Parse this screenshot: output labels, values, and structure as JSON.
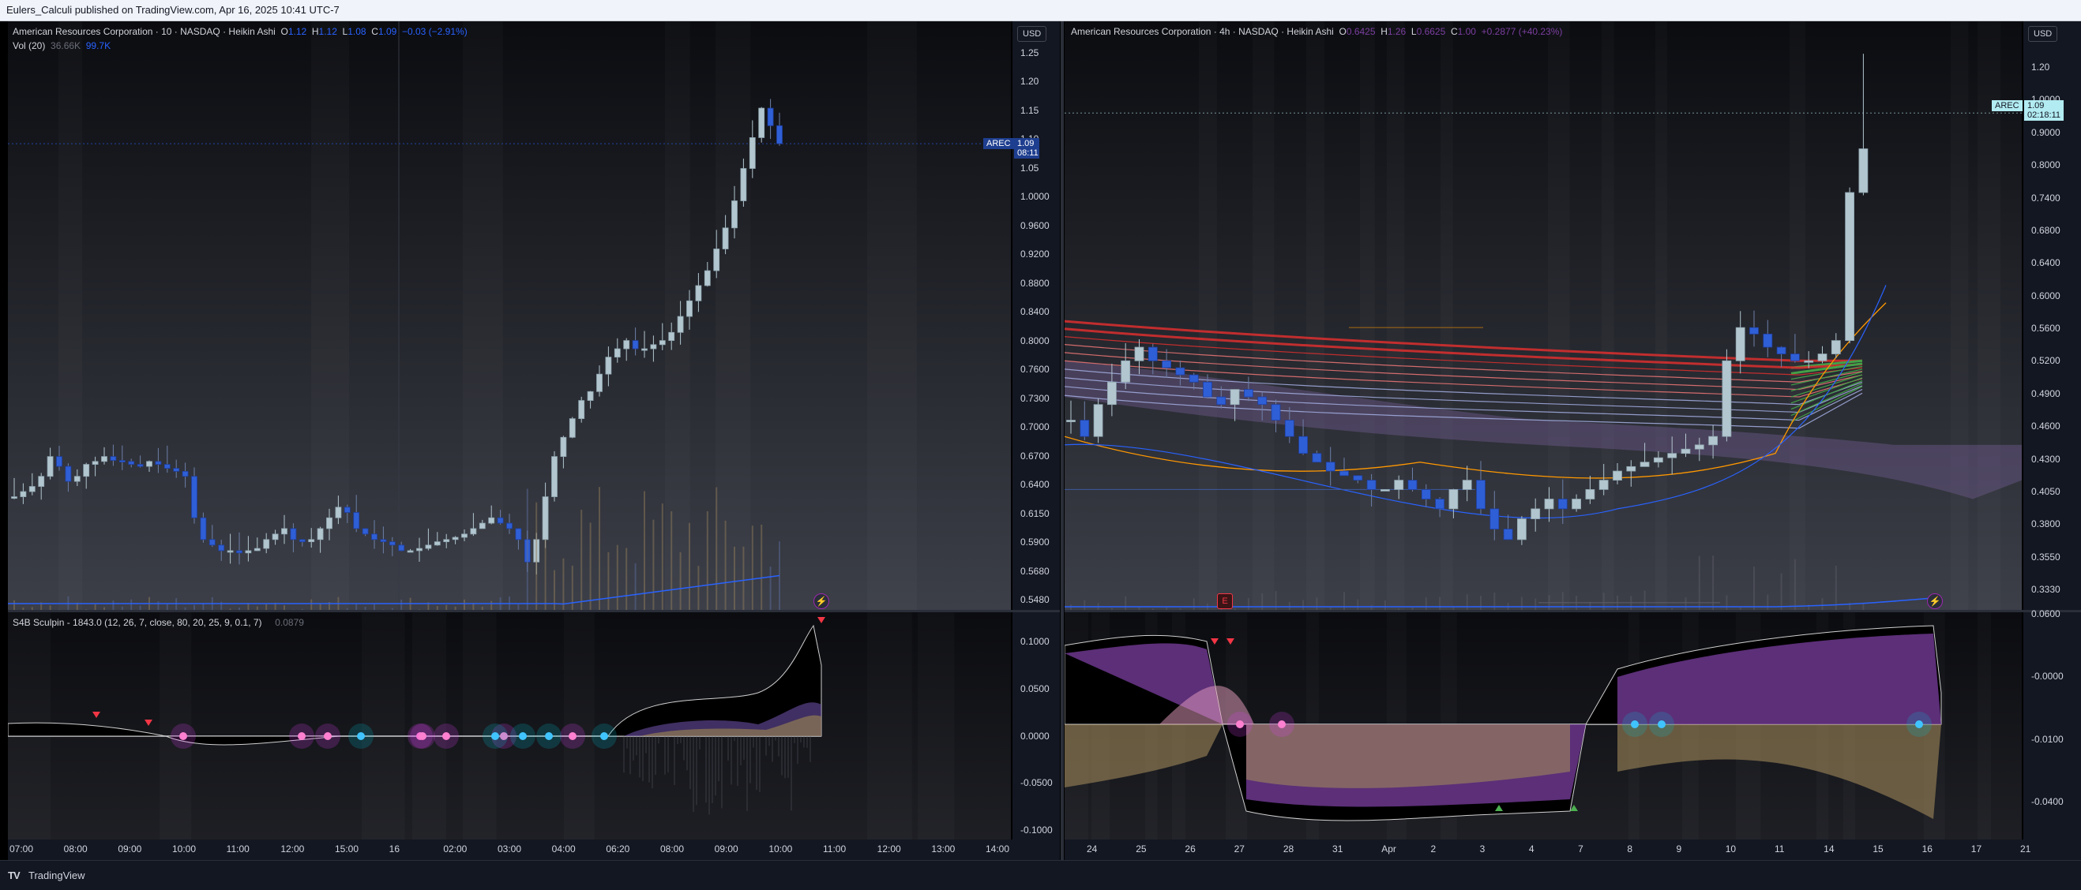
{
  "header": {
    "published_text": "Eulers_Calculi published on TradingView.com, Apr 16, 2025 10:41 UTC-7"
  },
  "left_chart": {
    "legend": {
      "title": "American Resources Corporation · 10 · NASDAQ · Heikin Ashi",
      "o_label": "O",
      "o": "1.12",
      "h_label": "H",
      "h": "1.12",
      "l_label": "L",
      "l": "1.08",
      "c_label": "C",
      "c": "1.09",
      "change": "−0.03 (−2.91%)",
      "vol_label": "Vol (20)",
      "vol_a": "36.66K",
      "vol_b": "99.7K"
    },
    "currency": "USD",
    "price_axis": [
      "1.25",
      "1.20",
      "1.15",
      "1.10",
      "1.05",
      "1.0000",
      "0.9600",
      "0.9200",
      "0.8800",
      "0.8400",
      "0.8000",
      "0.7600",
      "0.7300",
      "0.7000",
      "0.6700",
      "0.6400",
      "0.6150",
      "0.5900",
      "0.5680",
      "0.5480"
    ],
    "ticker_tag": "AREC",
    "last_price": "1.09",
    "countdown": "08:11",
    "indicator_legend": "S4B Sculpin - 1843.0 (12, 26, 7, close, 80, 20, 25, 9, 0.1, 7)",
    "indicator_value": "0.0879",
    "indicator_axis": [
      "0.1000",
      "0.0500",
      "0.0000",
      "-0.0500",
      "-0.1000"
    ],
    "time_axis": [
      "07:00",
      "08:00",
      "09:00",
      "10:00",
      "11:00",
      "12:00",
      "15:00",
      "16",
      "02:00",
      "03:00",
      "04:00",
      "06:20",
      "08:00",
      "09:00",
      "10:00",
      "11:00",
      "12:00",
      "13:00",
      "14:00"
    ]
  },
  "right_chart": {
    "legend": {
      "title": "American Resources Corporation · 4h · NASDAQ · Heikin Ashi",
      "o_label": "O",
      "o": "0.6425",
      "h_label": "H",
      "h": "1.26",
      "l_label": "L",
      "l": "0.6625",
      "c_label": "C",
      "c": "1.00",
      "change": "+0.2877 (+40.23%)"
    },
    "currency": "USD",
    "price_axis": [
      "1.20",
      "1.0000",
      "0.9000",
      "0.8000",
      "0.7400",
      "0.6800",
      "0.6400",
      "0.6000",
      "0.5600",
      "0.5200",
      "0.4900",
      "0.4600",
      "0.4300",
      "0.4050",
      "0.3800",
      "0.3550",
      "0.3330"
    ],
    "ticker_tag": "AREC",
    "last_price": "1.09",
    "countdown": "02:18:11",
    "indicator_axis": [
      "0.0600",
      "-0.0000",
      "-0.0100",
      "-0.0400"
    ],
    "time_axis": [
      "24",
      "25",
      "26",
      "27",
      "28",
      "31",
      "Apr",
      "2",
      "3",
      "4",
      "7",
      "8",
      "9",
      "10",
      "11",
      "14",
      "15",
      "16",
      "17",
      "21"
    ]
  },
  "footer": {
    "brand": "TradingView"
  },
  "colors": {
    "bg": "#131722",
    "up": "#b2c6cf",
    "down": "#2f5fd6",
    "accent": "#2962ff"
  }
}
